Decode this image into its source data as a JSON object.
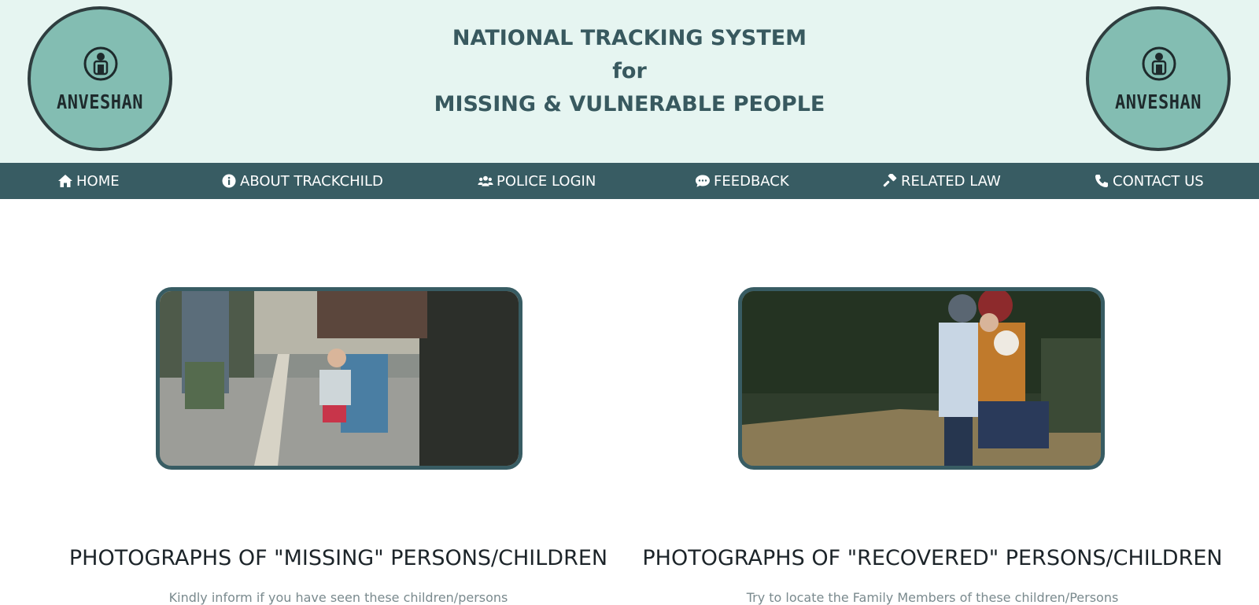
{
  "header": {
    "logo_text": "ANVESHAN",
    "title_line1": "NATIONAL TRACKING SYSTEM",
    "title_line2": "for",
    "title_line3": "MISSING & VULNERABLE PEOPLE"
  },
  "nav": {
    "items": [
      {
        "label": "HOME",
        "icon": "home-icon"
      },
      {
        "label": "ABOUT TRACKCHILD",
        "icon": "info-icon"
      },
      {
        "label": "POLICE LOGIN",
        "icon": "users-icon"
      },
      {
        "label": "FEEDBACK",
        "icon": "comment-icon"
      },
      {
        "label": "RELATED LAW",
        "icon": "gavel-icon"
      },
      {
        "label": "CONTACT US",
        "icon": "phone-icon"
      }
    ]
  },
  "sections": {
    "missing": {
      "heading": "PHOTOGRAPHS OF \"MISSING\" PERSONS/CHILDREN",
      "subtext": "Kindly inform if you have seen these children/persons"
    },
    "recovered": {
      "heading": "PHOTOGRAPHS OF \"RECOVERED\" PERSONS/CHILDREN",
      "subtext": "Try to locate the Family Members of these children/Persons"
    }
  },
  "colors": {
    "header_bg": "#e6f5f1",
    "nav_bg": "#385c63",
    "logo_fill": "#83bdb2",
    "title_color": "#38595f"
  }
}
